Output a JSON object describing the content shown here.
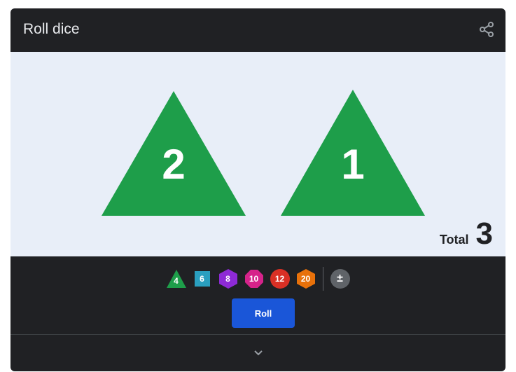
{
  "header": {
    "title": "Roll dice",
    "share_icon": "share-icon"
  },
  "results": {
    "dice": [
      {
        "type": "d4",
        "value": "2",
        "color": "#1e9e4a"
      },
      {
        "type": "d4",
        "value": "1",
        "color": "#1e9e4a"
      }
    ],
    "total_label": "Total",
    "total_value": "3"
  },
  "picker": {
    "dice": [
      {
        "label": "4",
        "shape": "triangle",
        "color": "#1e9e4a"
      },
      {
        "label": "6",
        "shape": "square",
        "color": "#2a9fbf"
      },
      {
        "label": "8",
        "shape": "hexagon",
        "color": "#8e2ad6"
      },
      {
        "label": "10",
        "shape": "octagon",
        "color": "#d6238a"
      },
      {
        "label": "12",
        "shape": "decagon",
        "color": "#d93025"
      },
      {
        "label": "20",
        "shape": "hexagon",
        "color": "#e8710a"
      },
      {
        "label": "±",
        "shape": "circle",
        "color": "#5f6368"
      }
    ]
  },
  "actions": {
    "roll_label": "Roll",
    "expand_icon": "chevron-down-icon"
  }
}
